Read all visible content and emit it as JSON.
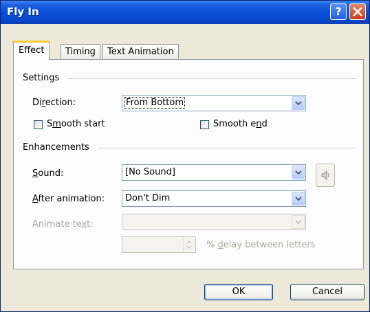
{
  "window": {
    "title": "Fly In",
    "help_glyph": "?",
    "close_icon": "close-icon"
  },
  "tabs": [
    {
      "label": "Effect",
      "active": true
    },
    {
      "label": "Timing",
      "active": false
    },
    {
      "label": "Text Animation",
      "active": false
    }
  ],
  "settings": {
    "group_label": "Settings",
    "direction": {
      "label_pre": "Di",
      "label_u": "r",
      "label_post": "ection:",
      "value": "From Bottom"
    },
    "smooth_start": {
      "label_pre": "S",
      "label_u": "m",
      "label_post": "ooth start",
      "checked": false
    },
    "smooth_end": {
      "label_pre": "Smooth e",
      "label_u": "n",
      "label_post": "d",
      "checked": false
    }
  },
  "enhancements": {
    "group_label": "Enhancements",
    "sound": {
      "label_u": "S",
      "label_post": "ound:",
      "value": "[No Sound]"
    },
    "after_animation": {
      "label_u": "A",
      "label_post": "fter animation:",
      "value": "Don't Dim"
    },
    "animate_text": {
      "label_pre": "Animate te",
      "label_u": "x",
      "label_post": "t:",
      "value": ""
    },
    "delay": {
      "label_pre": "% ",
      "label_u": "d",
      "label_post": "elay between letters",
      "value": ""
    }
  },
  "buttons": {
    "ok": "OK",
    "cancel": "Cancel"
  },
  "colors": {
    "titlebar": "#0a4fd8",
    "dialog_bg": "#ece9d8",
    "panel_bg": "#fcfcfe",
    "tab_highlight": "#ffc83c"
  }
}
